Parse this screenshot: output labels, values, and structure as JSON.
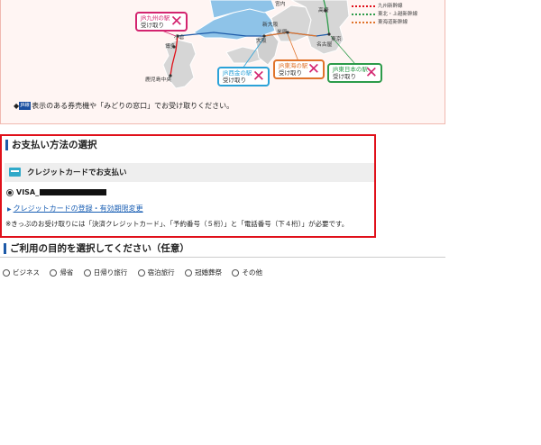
{
  "pickup": {
    "station_boxes": [
      {
        "id": "kyushu",
        "line1": "JR九州の駅",
        "line2": "受け取り",
        "color": "#d3246f"
      },
      {
        "id": "west",
        "line1": "JR西金の駅",
        "line2": "受け取り",
        "color": "#2ba2d8"
      },
      {
        "id": "tokai",
        "line1": "JR東海の駅",
        "line2": "受け取り",
        "color": "#e0732a"
      },
      {
        "id": "east",
        "line1": "JR東日本の駅",
        "line2": "受け取り",
        "color": "#2d9b4a"
      }
    ],
    "cities": {
      "kokura": "小倉",
      "hakata": "博多",
      "kagoshima": "鹿児島中央",
      "okayama": "岡山",
      "shin_osaka": "新大阪",
      "osaka": "大阪",
      "maibara": "米原",
      "nagoya": "名古屋",
      "tokyo": "東京",
      "omiya": "大宮",
      "takasaki": "高崎",
      "top_label": "宮内"
    },
    "legend": [
      {
        "label": "九州新幹線",
        "color": "#e0101a"
      },
      {
        "label": "東北・上越新幹線",
        "color": "#2d9b4a"
      },
      {
        "label": "東海道新幹線",
        "color": "#e0732a"
      }
    ],
    "mark_badge": "JR線",
    "mark_text": "表示のある券売機や「みどりの窓口」でお受け取りください。",
    "bullet": "◆"
  },
  "payment": {
    "title": "お支払い方法の選択",
    "sub_label": "クレジットカードでお支払い",
    "card_value": "VISA_",
    "card_link": "クレジットカードの登録・有効期限変更",
    "note": "※きっぷのお受け取りには「決済クレジットカード」、「予約番号（５桁）」と「電話番号（下４桁）」が必要です。"
  },
  "purpose": {
    "title": "ご利用の目的を選択してください（任意）",
    "options": [
      "ビジネス",
      "帰省",
      "日帰り旅行",
      "宿泊旅行",
      "冠婚葬祭",
      "その他"
    ]
  },
  "colors": {
    "accent_red": "#e0101a",
    "accent_blue": "#1d5aa8",
    "link": "#1a5fb4"
  }
}
